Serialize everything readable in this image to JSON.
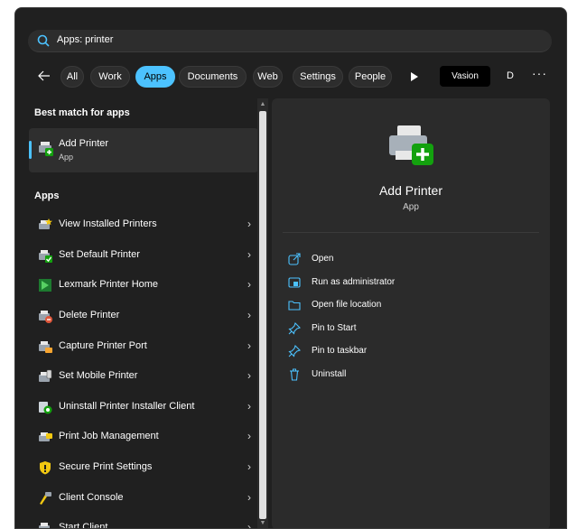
{
  "search": {
    "query": "Apps: printer"
  },
  "filters": {
    "chips": [
      "All",
      "Work",
      "Apps",
      "Documents",
      "Web",
      "Settings",
      "People"
    ],
    "active": "Apps",
    "account_label": "Vasion",
    "avatar_initial": "D",
    "more_label": "···"
  },
  "left": {
    "best_match_title": "Best match for apps",
    "best_match": {
      "name": "Add Printer",
      "type": "App"
    },
    "apps_title": "Apps",
    "apps": [
      {
        "label": "View Installed Printers",
        "icon": "printer-star-icon"
      },
      {
        "label": "Set Default Printer",
        "icon": "printer-check-icon"
      },
      {
        "label": "Lexmark Printer Home",
        "icon": "lexmark-icon"
      },
      {
        "label": "Delete Printer",
        "icon": "printer-delete-icon"
      },
      {
        "label": "Capture Printer Port",
        "icon": "printer-capture-icon"
      },
      {
        "label": "Set Mobile Printer",
        "icon": "printer-mobile-icon"
      },
      {
        "label": "Uninstall Printer Installer Client",
        "icon": "uninstall-client-icon"
      },
      {
        "label": "Print Job Management",
        "icon": "print-job-icon"
      },
      {
        "label": "Secure Print Settings",
        "icon": "shield-icon"
      },
      {
        "label": "Client Console",
        "icon": "console-icon"
      },
      {
        "label": "Start Client",
        "icon": "printer-start-icon"
      }
    ],
    "chevron": "›"
  },
  "detail": {
    "name": "Add Printer",
    "type": "App",
    "actions": [
      {
        "label": "Open",
        "icon": "open-external-icon"
      },
      {
        "label": "Run as administrator",
        "icon": "run-admin-icon"
      },
      {
        "label": "Open file location",
        "icon": "folder-icon"
      },
      {
        "label": "Pin to Start",
        "icon": "pin-icon"
      },
      {
        "label": "Pin to taskbar",
        "icon": "pin-icon"
      },
      {
        "label": "Uninstall",
        "icon": "trash-icon"
      }
    ]
  },
  "colors": {
    "accent": "#4cc2ff",
    "panel": "#202020",
    "detail_bg": "#2b2b2b"
  }
}
